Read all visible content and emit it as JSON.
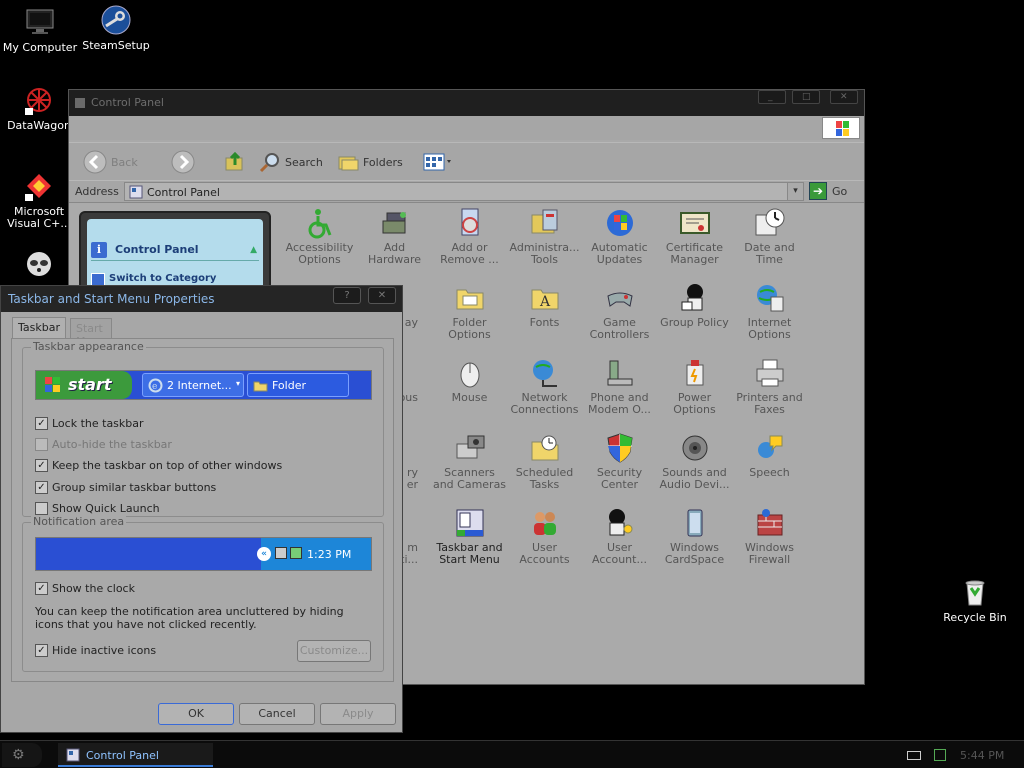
{
  "desktop": {
    "icons": [
      {
        "label": "My Computer",
        "icon": "my-computer-icon"
      },
      {
        "label": "SteamSetup",
        "icon": "steam-icon"
      },
      {
        "label": "DataWagon",
        "icon": "datawagon-icon"
      },
      {
        "label": "Microsoft Visual C+...",
        "icon": "visual-studio-icon"
      },
      {
        "label": "Recycle Bin",
        "icon": "recycle-bin-icon"
      }
    ]
  },
  "control_panel": {
    "title": "Control Panel",
    "toolbar": {
      "back": "Back",
      "search": "Search",
      "folders": "Folders"
    },
    "address": {
      "label": "Address",
      "value": "Control Panel",
      "go": "Go"
    },
    "task_pane": {
      "title": "Control Panel",
      "link": "Switch to Category"
    },
    "items": [
      {
        "l1": "Accessibility",
        "l2": "Options"
      },
      {
        "l1": "Add",
        "l2": "Hardware"
      },
      {
        "l1": "Add or",
        "l2": "Remove ..."
      },
      {
        "l1": "Administra...",
        "l2": "Tools"
      },
      {
        "l1": "Automatic",
        "l2": "Updates"
      },
      {
        "l1": "Certificate",
        "l2": "Manager"
      },
      {
        "l1": "Date and",
        "l2": "Time"
      },
      {
        "l1": "Folder",
        "l2": "Options"
      },
      {
        "l1": "Fonts",
        "l2": ""
      },
      {
        "l1": "Game",
        "l2": "Controllers"
      },
      {
        "l1": "Group Policy",
        "l2": ""
      },
      {
        "l1": "Internet",
        "l2": "Options"
      },
      {
        "l1": "Mouse",
        "l2": ""
      },
      {
        "l1": "Network",
        "l2": "Connections"
      },
      {
        "l1": "Phone and",
        "l2": "Modem O..."
      },
      {
        "l1": "Power",
        "l2": "Options"
      },
      {
        "l1": "Printers and",
        "l2": "Faxes"
      },
      {
        "l1": "Scanners",
        "l2": "and Cameras"
      },
      {
        "l1": "Scheduled",
        "l2": "Tasks"
      },
      {
        "l1": "Security",
        "l2": "Center"
      },
      {
        "l1": "Sounds and",
        "l2": "Audio Devi..."
      },
      {
        "l1": "Speech",
        "l2": ""
      },
      {
        "l1": "Taskbar and",
        "l2": "Start Menu"
      },
      {
        "l1": "User",
        "l2": "Accounts"
      },
      {
        "l1": "User",
        "l2": "Account..."
      },
      {
        "l1": "Windows",
        "l2": "CardSpace"
      },
      {
        "l1": "Windows",
        "l2": "Firewall"
      }
    ],
    "partial_labels": [
      "ay",
      "ous",
      "ry",
      "er",
      "m",
      "rati..."
    ]
  },
  "dialog": {
    "title": "Taskbar and Start Menu Properties",
    "tabs": [
      "Taskbar",
      "Start Menu"
    ],
    "appearance": {
      "group_label": "Taskbar appearance",
      "start_label": "start",
      "task1": "2 Internet...",
      "task2": "Folder",
      "options": [
        {
          "label": "Lock the taskbar",
          "checked": true,
          "enabled": true
        },
        {
          "label": "Auto-hide the taskbar",
          "checked": false,
          "enabled": false
        },
        {
          "label": "Keep the taskbar on top of other windows",
          "checked": true,
          "enabled": true
        },
        {
          "label": "Group similar taskbar buttons",
          "checked": true,
          "enabled": true
        },
        {
          "label": "Show Quick Launch",
          "checked": false,
          "enabled": true
        }
      ]
    },
    "notification": {
      "group_label": "Notification area",
      "clock": "1:23 PM",
      "show_clock": "Show the clock",
      "text": "You can keep the notification area uncluttered by hiding icons that you have not clicked recently.",
      "hide_inactive": "Hide inactive icons",
      "customize": "Customize..."
    },
    "buttons": {
      "ok": "OK",
      "cancel": "Cancel",
      "apply": "Apply"
    }
  },
  "taskbar": {
    "task": "Control Panel",
    "clock": "5:44 PM"
  }
}
